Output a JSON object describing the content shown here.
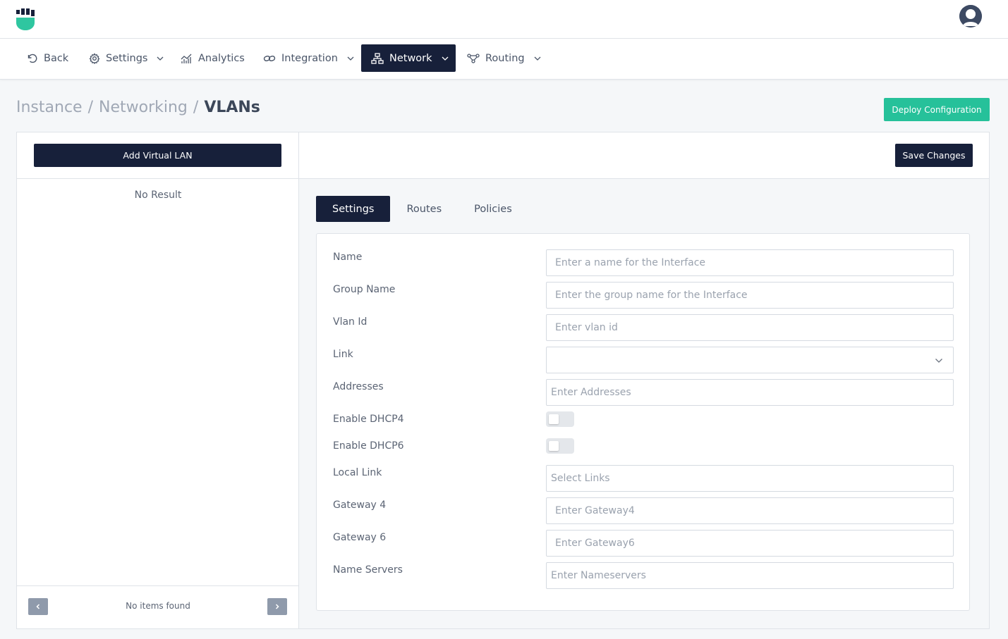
{
  "nav": {
    "back": "Back",
    "settings": "Settings",
    "analytics": "Analytics",
    "integration": "Integration",
    "network": "Network",
    "routing": "Routing"
  },
  "breadcrumb": {
    "items": [
      "Instance",
      "Networking"
    ],
    "separator": "/",
    "current": "VLANs"
  },
  "header": {
    "deploy_label": "Deploy Configuration"
  },
  "left": {
    "add_vlan_label": "Add Virtual LAN",
    "empty_text": "No Result",
    "pager_text": "No items found"
  },
  "right": {
    "save_label": "Save Changes",
    "tabs": [
      "Settings",
      "Routes",
      "Policies"
    ],
    "active_tab": "Settings"
  },
  "form": {
    "name": {
      "label": "Name",
      "placeholder": "Enter a name for the Interface"
    },
    "group_name": {
      "label": "Group Name",
      "placeholder": "Enter the group name for the Interface"
    },
    "vlan_id": {
      "label": "Vlan Id",
      "placeholder": "Enter vlan id"
    },
    "link": {
      "label": "Link",
      "value": ""
    },
    "addresses": {
      "label": "Addresses",
      "placeholder": "Enter Addresses"
    },
    "dhcp4": {
      "label": "Enable DHCP4",
      "enabled": false
    },
    "dhcp6": {
      "label": "Enable DHCP6",
      "enabled": false
    },
    "local_link": {
      "label": "Local Link",
      "placeholder": "Select Links"
    },
    "gateway4": {
      "label": "Gateway 4",
      "placeholder": "Enter Gateway4"
    },
    "gateway6": {
      "label": "Gateway 6",
      "placeholder": "Enter Gateway6"
    },
    "nameservers": {
      "label": "Name Servers",
      "placeholder": "Enter Nameservers"
    }
  },
  "colors": {
    "primary_dark": "#17203a",
    "accent_green": "#26c19a",
    "logo_green": "#2fc6a0",
    "pager_gray": "#8f9aab"
  }
}
